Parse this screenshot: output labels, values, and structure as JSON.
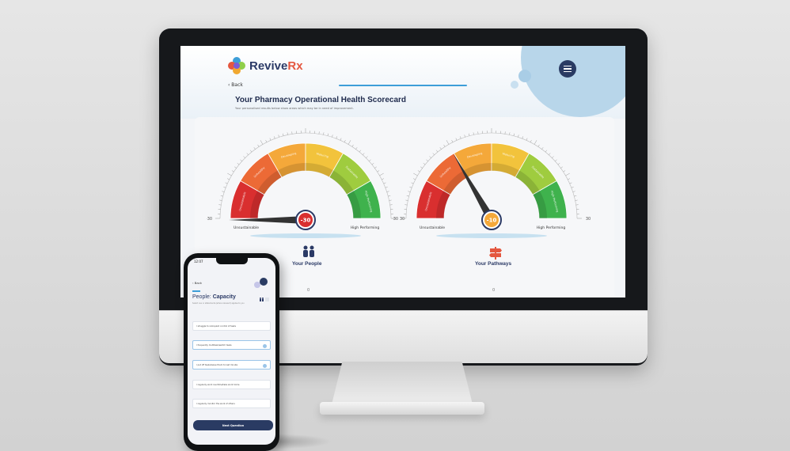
{
  "app": {
    "brand": "Revive",
    "brand_rx": "Rx"
  },
  "desktop": {
    "back": "‹ Back",
    "title": "Your Pharmacy Operational Health Scorecard",
    "subtitle": "Your personalised results below show areas which may be in need of improvement.",
    "gauges": [
      {
        "label": "Your People",
        "value": "-30",
        "value_num": -30,
        "left_label": "Unsustainable",
        "right_label": "High Performing",
        "min": "-30",
        "max": "30",
        "icon": "people-icon",
        "bottom_mark": "0"
      },
      {
        "label": "Your Pathways",
        "value": "-10",
        "value_num": -10,
        "left_label": "Unsustainable",
        "right_label": "High Performing",
        "min": "-30",
        "max": "30",
        "icon": "signpost-icon",
        "bottom_mark": "0"
      }
    ],
    "segment_labels": [
      "Unsustainable",
      "Unhealthy",
      "Developing",
      "Maturing",
      "Sustainable",
      "High Performing"
    ],
    "colors": {
      "navy": "#2b3a66",
      "accent": "#e4573f",
      "blue": "#3d9ed8"
    }
  },
  "phone": {
    "time": "12:07",
    "back": "‹ Back",
    "title_prefix": "People:",
    "title_main": "Capacity",
    "subtitle": "Select one or statements (where relevant) applies to you",
    "options": [
      {
        "text": "I struggle to relinquish control of tasks",
        "selected": false
      },
      {
        "text": "I frequently multitask/switch tasks",
        "selected": true
      },
      {
        "text": "I put off tasks/leave them to last minute",
        "selected": true
      },
      {
        "text": "I regularly work overtime/take work home",
        "selected": false
      },
      {
        "text": "I regularly monitor the work of others",
        "selected": false
      }
    ],
    "next_button": "Next Question"
  }
}
